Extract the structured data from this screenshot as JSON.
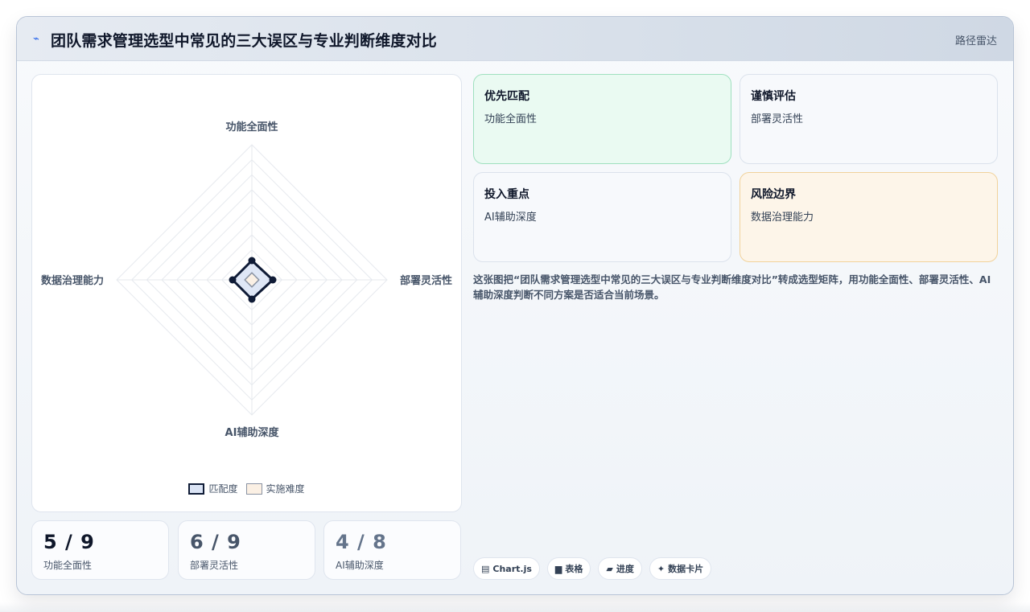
{
  "header": {
    "title": "团队需求管理选型中常见的三大误区与专业判断维度对比",
    "tag": "路径雷达"
  },
  "chart_data": {
    "type": "radar",
    "axes": [
      "功能全面性",
      "部署灵活性",
      "AI辅助深度",
      "数据治理能力"
    ],
    "scale_max": 9,
    "grid_levels": 9,
    "series": [
      {
        "name": "匹配度",
        "values": [
          0.6,
          0.65,
          0.6,
          0.6
        ],
        "fill": "#dbe4f5",
        "stroke": "#0f1b36"
      },
      {
        "name": "实施难度",
        "values": [
          0.22,
          0.22,
          0.22,
          0.22
        ],
        "fill": "#fbf0e4",
        "stroke": "#8a93a3"
      }
    ]
  },
  "stats": [
    {
      "value": "5 / 9",
      "label": "功能全面性",
      "color": "#0f172a"
    },
    {
      "value": "6 / 9",
      "label": "部署灵活性",
      "color": "#475569"
    },
    {
      "value": "4 / 8",
      "label": "AI辅助深度",
      "color": "#64748b"
    }
  ],
  "cards": [
    {
      "title": "优先匹配",
      "subtitle": "功能全面性"
    },
    {
      "title": "谨慎评估",
      "subtitle": "部署灵活性"
    },
    {
      "title": "投入重点",
      "subtitle": "AI辅助深度"
    },
    {
      "title": "风险边界",
      "subtitle": "数据治理能力"
    }
  ],
  "description": "这张图把“团队需求管理选型中常见的三大误区与专业判断维度对比”转成选型矩阵，用功能全面性、部署灵活性、AI辅助深度判断不同方案是否适合当前场景。",
  "chips": [
    {
      "icon": "▤",
      "label": "Chart.js"
    },
    {
      "icon": "▆",
      "label": "表格"
    },
    {
      "icon": "▰",
      "label": "进度"
    },
    {
      "icon": "✦",
      "label": "数据卡片"
    }
  ]
}
